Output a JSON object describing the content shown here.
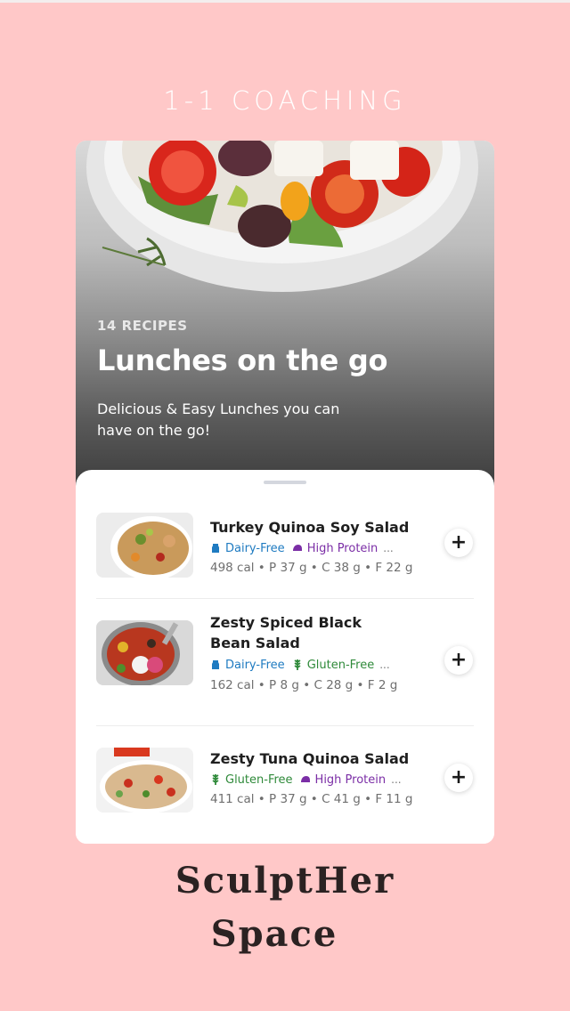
{
  "header": {
    "title": "1-1 COACHING"
  },
  "collection": {
    "count_label": "14 RECIPES",
    "title": "Lunches on the go",
    "subtitle": "Delicious & Easy Lunches you can have on the go!"
  },
  "recipes": [
    {
      "name": "Turkey Quinoa Soy Salad",
      "tags": [
        {
          "label": "Dairy-Free",
          "icon": "milk-carton-icon",
          "color": "#1f7bc1"
        },
        {
          "label": "High Protein",
          "icon": "protein-icon",
          "color": "#7b2ea6"
        }
      ],
      "more": "...",
      "macros": "498 cal • P 37 g • C 38 g • F 22 g",
      "add_label": "+"
    },
    {
      "name": "Zesty Spiced Black Bean Salad",
      "tags": [
        {
          "label": "Dairy-Free",
          "icon": "milk-carton-icon",
          "color": "#1f7bc1"
        },
        {
          "label": "Gluten-Free",
          "icon": "wheat-icon",
          "color": "#2f8a3a"
        }
      ],
      "more": "...",
      "macros": "162 cal • P 8 g • C 28 g • F 2 g",
      "add_label": "+"
    },
    {
      "name": "Zesty Tuna Quinoa Salad",
      "tags": [
        {
          "label": "Gluten-Free",
          "icon": "wheat-icon",
          "color": "#2f8a3a"
        },
        {
          "label": "High Protein",
          "icon": "protein-icon",
          "color": "#7b2ea6"
        }
      ],
      "more": "...",
      "macros": "411 cal • P 37 g • C 41 g • F 11 g",
      "add_label": "+"
    }
  ],
  "brand": {
    "line1": "SculptHer",
    "line2": "Space"
  }
}
